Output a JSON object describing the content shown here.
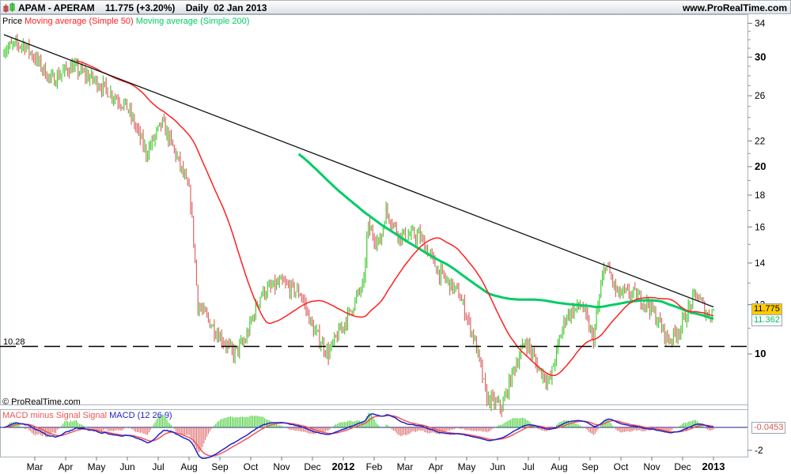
{
  "header": {
    "title": "APAM - APERAM    11.775 (+3.20%)    Daily  02 Jan 2013",
    "site": "www.ProRealTime.com"
  },
  "legend": {
    "price": "Price",
    "ma50": "Moving average (Simple 50)",
    "ma200": "Moving average (Simple 200)"
  },
  "copyright": "© ProRealTime.com",
  "macd_legend": {
    "hist": "MACD minus Signal Signal",
    "macd": "MACD (12 26 9)"
  },
  "tags": {
    "last": "11.775",
    "ma200": "11.362",
    "macd": "-0.0453",
    "support": "10.28"
  },
  "colors": {
    "up": "#44cc33",
    "down": "#dd6666",
    "ma50": "#ff2020",
    "ma200": "#00cc66",
    "macd": "#2222cc",
    "signal": "#ee5555",
    "tag_bg": "#ffcc00"
  },
  "chart_data": {
    "type": "line",
    "title": "APAM - APERAM Daily",
    "yscale": "log",
    "ylim": [
      7.4,
      35
    ],
    "yticks": [
      34,
      30,
      26,
      22,
      20,
      18,
      16,
      14,
      12,
      10
    ],
    "x_ticks": [
      "Mar",
      "Apr",
      "May",
      "Jun",
      "Jul",
      "Aug",
      "Sep",
      "Oct",
      "Nov",
      "Dec",
      "2012",
      "Feb",
      "Mar",
      "Apr",
      "May",
      "Jun",
      "Jul",
      "Aug",
      "Sep",
      "Oct",
      "Nov",
      "Dec",
      "2013"
    ],
    "x_unit": "months since 1 Mar 2011",
    "price_keypoints": [
      [
        -1,
        31
      ],
      [
        -0.36,
        31.5
      ],
      [
        0.54,
        27.5
      ],
      [
        1.18,
        29
      ],
      [
        1.95,
        27.5
      ],
      [
        2.97,
        25
      ],
      [
        3.62,
        21
      ],
      [
        4.13,
        23.5
      ],
      [
        4.64,
        20.5
      ],
      [
        5.03,
        18
      ],
      [
        5.28,
        12
      ],
      [
        5.8,
        11
      ],
      [
        6.44,
        10
      ],
      [
        6.82,
        10.5
      ],
      [
        7.33,
        12.5
      ],
      [
        7.97,
        13
      ],
      [
        8.62,
        12.5
      ],
      [
        9.0,
        11
      ],
      [
        9.51,
        10
      ],
      [
        10.15,
        11.5
      ],
      [
        10.67,
        13
      ],
      [
        10.79,
        16
      ],
      [
        11.18,
        15
      ],
      [
        11.38,
        17
      ],
      [
        11.82,
        15.5
      ],
      [
        12.46,
        15.5
      ],
      [
        13.1,
        13.5
      ],
      [
        13.74,
        12.5
      ],
      [
        14.26,
        10.5
      ],
      [
        14.64,
        8.5
      ],
      [
        15.15,
        8.2
      ],
      [
        15.54,
        9.5
      ],
      [
        15.92,
        10.5
      ],
      [
        16.31,
        9.5
      ],
      [
        16.69,
        9
      ],
      [
        17.21,
        11.5
      ],
      [
        17.72,
        12
      ],
      [
        18.1,
        10.5
      ],
      [
        18.49,
        14
      ],
      [
        18.87,
        12.5
      ],
      [
        19.38,
        12.5
      ],
      [
        19.9,
        12
      ],
      [
        20.54,
        10.5
      ],
      [
        20.92,
        11
      ],
      [
        21.44,
        12.5
      ],
      [
        21.82,
        11.5
      ],
      [
        22.0,
        11.775
      ]
    ],
    "trendline": [
      [
        -1,
        32.6
      ],
      [
        22.0,
        11.9
      ]
    ],
    "support_level": 10.28,
    "last": 11.775,
    "ma200_last": 11.362,
    "macd_params": [
      12,
      26,
      9
    ],
    "macd_last": -0.0453,
    "macd_yticks": [
      -2
    ]
  }
}
